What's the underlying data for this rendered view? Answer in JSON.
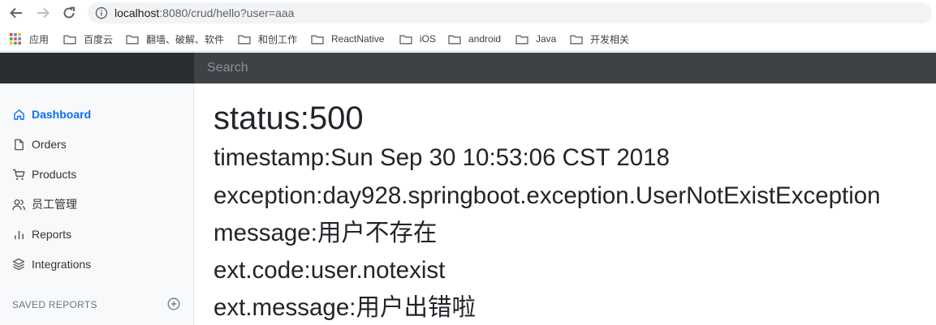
{
  "browser": {
    "url_host": "localhost",
    "url_rest": ":8080/crud/hello?user=aaa",
    "bookmarks": [
      "应用",
      "百度云",
      "翻墙、破解、软件",
      "和创工作",
      "ReactNative",
      "iOS",
      "android",
      "Java",
      "开发相关"
    ]
  },
  "search": {
    "placeholder": "Search"
  },
  "sidebar": {
    "items": [
      {
        "label": "Dashboard",
        "icon": "home-icon",
        "active": true
      },
      {
        "label": "Orders",
        "icon": "file-icon"
      },
      {
        "label": "Products",
        "icon": "shopping-cart-icon"
      },
      {
        "label": "员工管理",
        "icon": "users-icon"
      },
      {
        "label": "Reports",
        "icon": "bar-chart-icon"
      },
      {
        "label": "Integrations",
        "icon": "layers-icon"
      }
    ],
    "saved_reports_label": "SAVED REPORTS"
  },
  "main": {
    "status": "status:500",
    "timestamp": "timestamp:Sun Sep 30 10:53:06 CST 2018",
    "exception": "exception:day928.springboot.exception.UserNotExistException",
    "message": "message:用户不存在",
    "ext_code": "ext.code:user.notexist",
    "ext_message": "ext.message:用户出错啦"
  },
  "colors": {
    "accent": "#0d6efd",
    "topbar": "#2a2d31",
    "search_bg": "#3d4247",
    "sidebar_bg": "#f8f9fa"
  }
}
